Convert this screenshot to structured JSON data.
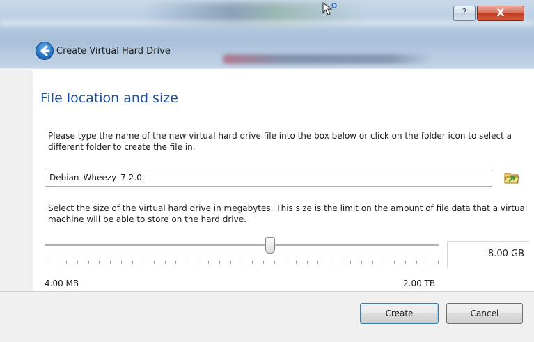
{
  "window": {
    "title_text": "Create Virtual Hard Drive",
    "help_label": "?",
    "close_label": "X"
  },
  "page": {
    "heading": "File location and size",
    "location_description": "Please type the name of the new virtual hard drive file into the box below or click on the folder icon to select a different folder to create the file in.",
    "file_name_value": "Debian_Wheezy_7.2.0",
    "size_description": "Select the size of the virtual hard drive in megabytes. This size is the limit on the amount of file data that a virtual machine will be able to store on the hard drive.",
    "size_value": "8.00 GB",
    "slider_position_fraction": 0.57,
    "min_label": "4.00 MB",
    "max_label": "2.00 TB"
  },
  "buttons": {
    "create": "Create",
    "cancel": "Cancel"
  },
  "icons": {
    "back": "back-arrow-icon",
    "folder": "folder-icon",
    "help": "help-icon",
    "close": "close-icon"
  },
  "colors": {
    "heading": "#1a4fa0",
    "accent_border": "#3c7fb1"
  }
}
